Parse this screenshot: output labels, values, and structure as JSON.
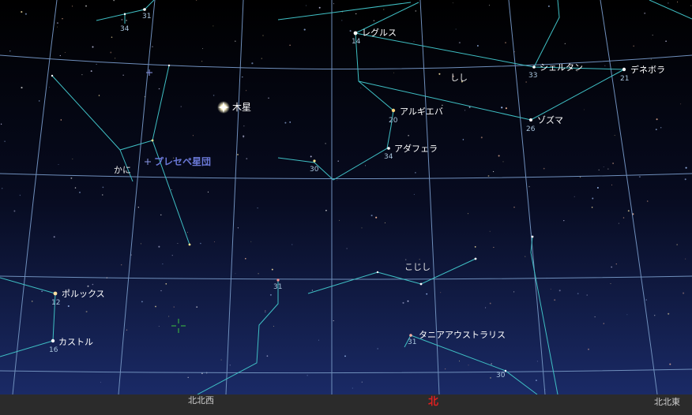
{
  "colors": {
    "sky_top": "#000000",
    "sky_bottom": "#1a2a66",
    "grid": "#6f8fbc",
    "constellation_line": "#3fbfc4",
    "ground": "#2b2b2b",
    "north_marker": "#e02020",
    "cluster_label": "#6a78d6",
    "reticle": "#3ec53e"
  },
  "planet": {
    "label": "木星"
  },
  "cluster": {
    "label": "プレセペ星団",
    "icon": "cluster-icon"
  },
  "constellations": {
    "leo": "しし",
    "cancer": "かに",
    "leo_minor": "こじし"
  },
  "stars": {
    "regulus": {
      "name": "レグルス",
      "mag": "14"
    },
    "shertan": {
      "name": "シェルタン",
      "mag": "33"
    },
    "denebola": {
      "name": "デネボラ",
      "mag": "21"
    },
    "algieba": {
      "name": "アルギエバ",
      "mag": "20"
    },
    "zosma": {
      "name": "ゾズマ",
      "mag": "26"
    },
    "adhafera": {
      "name": "アダフェラ",
      "mag": "34"
    },
    "pollux": {
      "name": "ポルックス",
      "mag": "12"
    },
    "castor": {
      "name": "カストル",
      "mag": "16"
    },
    "tania": {
      "name": "タニアアウストラリス",
      "mag": "31"
    }
  },
  "magnitudes": {
    "top_left_a": "31",
    "top_left_b": "34",
    "cancer_star": "30",
    "lynx_star": "31",
    "bottom_right": "30"
  },
  "horizon": {
    "left": "北北西",
    "center": "北",
    "right": "北北東"
  }
}
